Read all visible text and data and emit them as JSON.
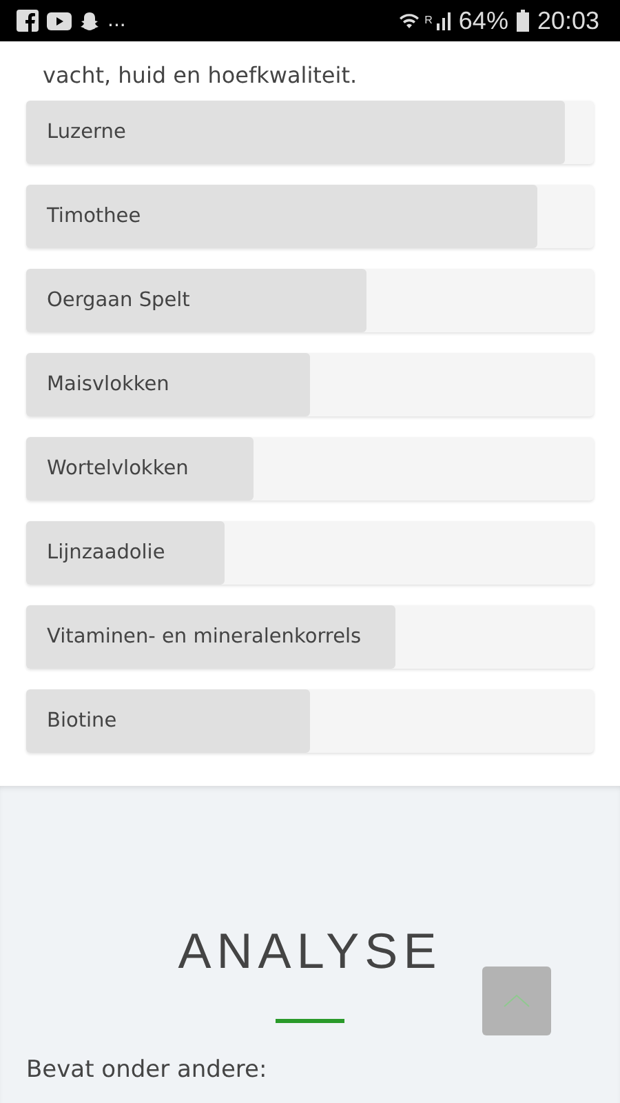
{
  "status_bar": {
    "more": "...",
    "battery_text": "64%",
    "time": "20:03",
    "roaming": "R"
  },
  "intro_text": "vacht, huid en hoefkwaliteit.",
  "ingredients": [
    {
      "name": "Luzerne",
      "level": 0.95
    },
    {
      "name": "Timothee",
      "level": 0.9
    },
    {
      "name": "Oergaan Spelt",
      "level": 0.6
    },
    {
      "name": "Maisvlokken",
      "level": 0.5
    },
    {
      "name": "Wortelvlokken",
      "level": 0.4
    },
    {
      "name": "Lijnzaadolie",
      "level": 0.35
    },
    {
      "name": "Vitaminen- en mineralenkorrels",
      "level": 0.65
    },
    {
      "name": "Biotine",
      "level": 0.5
    }
  ],
  "analysis": {
    "title": "ANALYSE",
    "intro": "Bevat onder andere:"
  }
}
